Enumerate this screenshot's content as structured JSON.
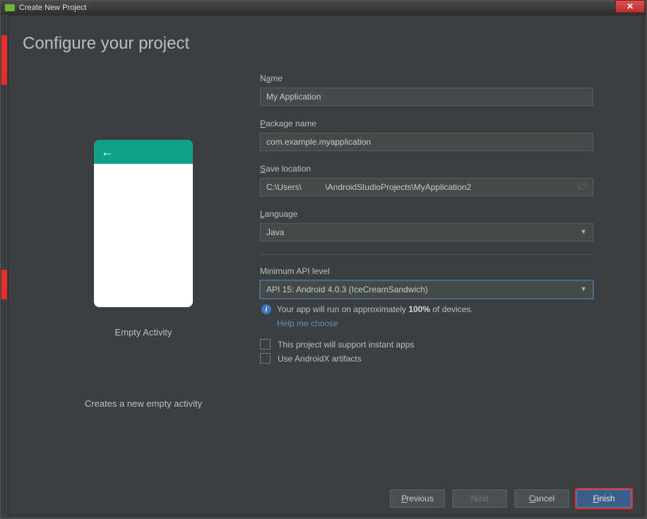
{
  "window": {
    "title": "Create New Project"
  },
  "heading": "Configure your project",
  "preview": {
    "title": "Empty Activity",
    "description": "Creates a new empty activity"
  },
  "fields": {
    "name": {
      "label_pre": "N",
      "label_underline": "a",
      "label_post": "me",
      "value": "My Application"
    },
    "package": {
      "label_pre": "",
      "label_underline": "P",
      "label_post": "ackage name",
      "value": "com.example.myapplication"
    },
    "save": {
      "label_pre": "",
      "label_underline": "S",
      "label_post": "ave location",
      "value": "C:\\Users\\          \\AndroidStudioProjects\\MyApplication2"
    },
    "language": {
      "label_pre": "",
      "label_underline": "L",
      "label_post": "anguage",
      "value": "Java"
    },
    "minapi": {
      "label": "Minimum API level",
      "value": "API 15: Android 4.0.3 (IceCreamSandwich)"
    }
  },
  "info": {
    "text_pre": "Your app will run on approximately ",
    "bold": "100%",
    "text_post": " of devices.",
    "help": "Help me choose"
  },
  "checkboxes": {
    "instant": "This project will support instant apps",
    "androidx": "Use AndroidX artifacts"
  },
  "buttons": {
    "previous": "Previous",
    "next": "Next",
    "cancel": "Cancel",
    "finish": "Finish"
  }
}
